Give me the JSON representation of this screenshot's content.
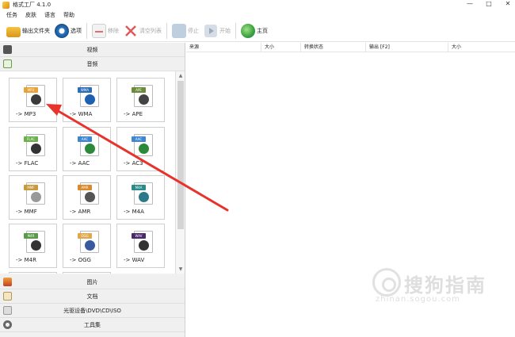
{
  "window": {
    "title": "格式工厂 4.1.0",
    "controls": [
      "—",
      "□",
      "✕"
    ]
  },
  "menu": [
    "任务",
    "皮肤",
    "语言",
    "帮助"
  ],
  "toolbar": {
    "output_folder": "输出文件夹",
    "options": "选项",
    "remove": "移除",
    "clear_list": "清空列表",
    "stop": "停止",
    "start": "开始",
    "home": "主页"
  },
  "categories": {
    "video": "视频",
    "audio": "音频",
    "image": "图片",
    "document": "文档",
    "optical": "光驱设备\\DVD\\CD\\ISO",
    "toolbox": "工具集"
  },
  "formats": [
    {
      "band": "MP3",
      "label": "-> MP3",
      "color": "#e8a23a"
    },
    {
      "band": "WMA",
      "label": "-> WMA",
      "color": "#2c6fb8"
    },
    {
      "band": "APE",
      "label": "-> APE",
      "color": "#6b8a3a"
    },
    {
      "band": "FLAC",
      "label": "-> FLAC",
      "color": "#6ab04c"
    },
    {
      "band": "AAC",
      "label": "-> AAC",
      "color": "#3f86d1"
    },
    {
      "band": "AAC",
      "label": "-> AC3",
      "color": "#3f86d1"
    },
    {
      "band": "MMF",
      "label": "-> MMF",
      "color": "#c89a3c"
    },
    {
      "band": "AMR",
      "label": "-> AMR",
      "color": "#d98a2c"
    },
    {
      "band": "M4A",
      "label": "-> M4A",
      "color": "#2b8a8a"
    },
    {
      "band": "M4R",
      "label": "-> M4R",
      "color": "#5a9a4a"
    },
    {
      "band": "OGG",
      "label": "-> OGG",
      "color": "#e0a84a"
    },
    {
      "band": "WAV",
      "label": "-> WAV",
      "color": "#4a2a6a"
    }
  ],
  "table_headers": [
    "来源",
    "大小",
    "转换状态",
    "输出 [F2]",
    "大小"
  ],
  "watermark": {
    "brand": "搜狗指南",
    "url": "zhinan.sogou.com"
  },
  "colors": {
    "arrow": "#e8332c",
    "accent": "#2c6fb8"
  }
}
